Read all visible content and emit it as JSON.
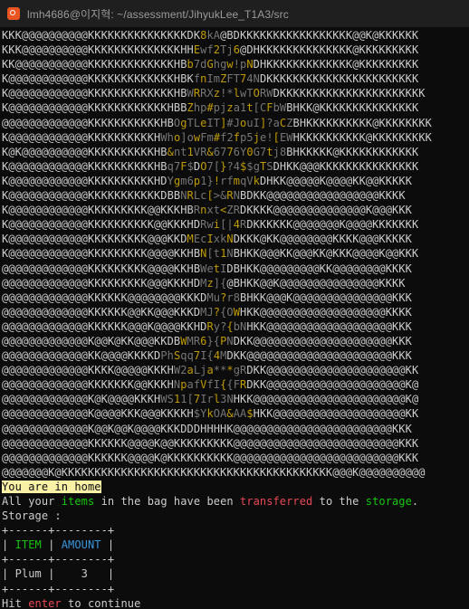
{
  "window": {
    "title": "lmh4686@이지혁: ~/assessment/JihyukLee_T1A3/src"
  },
  "ascii_art": [
    "KKK@@@@@@@@@@KKKKKKKKKKKKKKKDK8kA@BDKKKKKKKKKKKKKKKKK@@K@KKKKKK",
    "KKK@@@@@@@@@@KKKKKKKKKKKKKKHHEwf2Tj6@DHKKKKKKKKKKKKKK@KKKKKKKKK",
    "KK@@@@@@@@@@@KKKKKKKKKKKKKHBb7dGhgw!pNDHKKKKKKKKKKKKK@KKKKKKKKK",
    "K@@@@@@@@@@@@KKKKKKKKKKKKKHBKfnImZFT74NDKKKKKKKKKKKKKKKKKKKKKKK",
    "K@@@@@@@@@@@@KKKKKKKKKKKKKHBWRRXz!*lwTORWDKKKKKKKKKKKKKKKKKKKKKK",
    "K@@@@@@@@@@@@KKKKKKKKKKKKHBBZhp#pjza1t[CFbWBHKK@KKKKKKKKKKKKKKK",
    "@@@@@@@@@@@@@KKKKKKKKKKKHBOgTLeIT]#JouI]?aCZBHKKKKKKKKKK@KKKKKKKK",
    "K@@@@@@@@@@@@KKKKKKKKKKHWho]owFm#f2fp5je![EWHKKKKKKKKKK@KKKKKKKKK",
    "K@K@@@@@@@@@@KKKKKKKKKKHB&nt1VR&6776Y0G7tj8BHKKKKK@KKKKKKKKKKKK",
    "K@@@@@@@@@@@@KKKKKKKKKKHBq7F$DO7[}?4$$gTSDHKK@@@KKKKKKKKKKKKKKK",
    "K@@@@@@@@@@@@KKKKKKKKKKHDYgm6p1}!rfmqVkDHKK@@@@@K@@@@KK@@KKKKK",
    "K@@@@@@@@@@@@KKKKKKKKKKKDBBNRLc[>&RNBDKK@@@@@@@@@@@@@@@@@KKKK",
    "K@@@@@@@@@@@@KKKKKKKKK@@KKKHBRnxt<ZRDKKKK@@@@@@@@@@@@@@K@@@KKK",
    "K@@@@@@@@@@@@KKKKKKKKKK@@KKKHDRwi[|4RDKKKKKK@@@@@@@K@@@@KKKKKKK",
    "K@@@@@@@@@@@@KKKKKKKKK@@@KKDMEcIxkNDKKK@KK@@@@@@@@KKKK@@@KKKKK",
    "K@@@@@@@@@@@@KKKKKKKKK@@@@KKHBN[t1NBHKK@@@KK@@@KK@KKK@@@@K@@KKK",
    "@@@@@@@@@@@@@KKKKKKKKK@@@@KKHBWetIDBHKK@@@@@@@@@KK@@@@@@@@KKKK",
    "@@@@@@@@@@@@@KKKKKKKKK@@@KKKHDMz]{@BHKK@@K@@@@@@@@@@@@@@@KKKK",
    "@@@@@@@@@@@@@KKKKKK@@@@@@@@KKKDMu?r8BHKK@@@K@@@@@@@@@@@@@@@KKK",
    "@@@@@@@@@@@@@KKKKKK@@KK@@@KKKDMJ?{OWHKK@@@@@@@@@@@@@@@@@@@KKKK",
    "@@@@@@@@@@@@@KKKKKK@@@K@@@@KKHDRy?{bNHKK@@@@@@@@@@@@@@@@@@@KKK",
    "@@@@@@@@@@@@@K@@K@KK@@@KKDBWMR6}{PNDKK@@@@@@@@@@@@@@@@@@@@@KKK",
    "@@@@@@@@@@@@@KK@@@@KKKKDPhSqq7I{4MDKK@@@@@@@@@@@@@@@@@@@@@@KKK",
    "@@@@@@@@@@@@@KKKK@@@@@KKKHW2aLja***gRDKK@@@@@@@@@@@@@@@@@@@@@KK",
    "@@@@@@@@@@@@@KKKKKKK@@KKKHNpafVfI{{FRDKK@@@@@@@@@@@@@@@@@@@@@K@",
    "@@@@@@@@@@@@@K@K@@@@KKKHWS11[7Irl3NHKK@@@@@@@@@@@@@@@@@@@@@@@K@",
    "@@@@@@@@@@@@@K@@@@KKK@@@KKKKH$YkOA&AA$HKK@@@@@@@@@@@@@@@@@@@@KK",
    "@@@@@@@@@@@@@K@@K@@K@@@@KKKDDDHHHHK@@@@@@@@@@@@@@@@@@@@@@@@KKK",
    "@@@@@@@@@@@@@KKKKKK@@@@K@@KKKKKKKKK@@@@@@@@@@@@@@@@@@@@@@@@@KKK",
    "@@@@@@@@@@@@@KKKKKK@@@@K@KKKKKKKKKK@@@@@@@@@@@@@@@@@@@@@@@@@KKK",
    "@@@@@@@K@KKKKKKKKKKKKKKKKKKKKKKKKKKKKKKKKKKKKKKKKK@@@K@@@@@@@@@@"
  ],
  "location_banner": "You are in home",
  "transfer_message": {
    "part1": "All your ",
    "items_word": "items",
    "part2": " in the bag have been ",
    "transferred_word": "transferred",
    "part3": " to the ",
    "storage_word": "storage",
    "part4": "."
  },
  "storage_label": "Storage :",
  "table": {
    "border_top": "+------+--------+",
    "header_item": "ITEM",
    "header_amount": "AMOUNT",
    "border_mid": "+------+--------+",
    "rows": [
      {
        "item": "Plum",
        "amount": "3"
      }
    ],
    "border_bottom": "+------+--------+"
  },
  "prompt": {
    "part1": "Hit ",
    "enter_word": "enter",
    "part2": " to continue"
  },
  "colors": {
    "terminal_bg": "#0c0c0c",
    "terminal_fg": "#cccccc",
    "highlight_bg": "#f9f1a5",
    "green": "#16c60c",
    "red": "#e74856",
    "cyan": "#3a96dd"
  }
}
